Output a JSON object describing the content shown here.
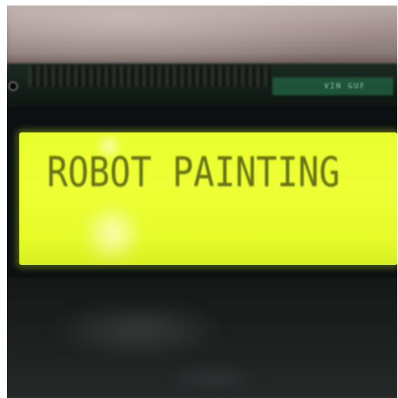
{
  "lcd": {
    "line1": "ROBOT PAINTING",
    "backlight_color": "#eeff35",
    "text_color": "#4f5a12"
  },
  "board": {
    "silkscreen": "VIN GUF"
  }
}
